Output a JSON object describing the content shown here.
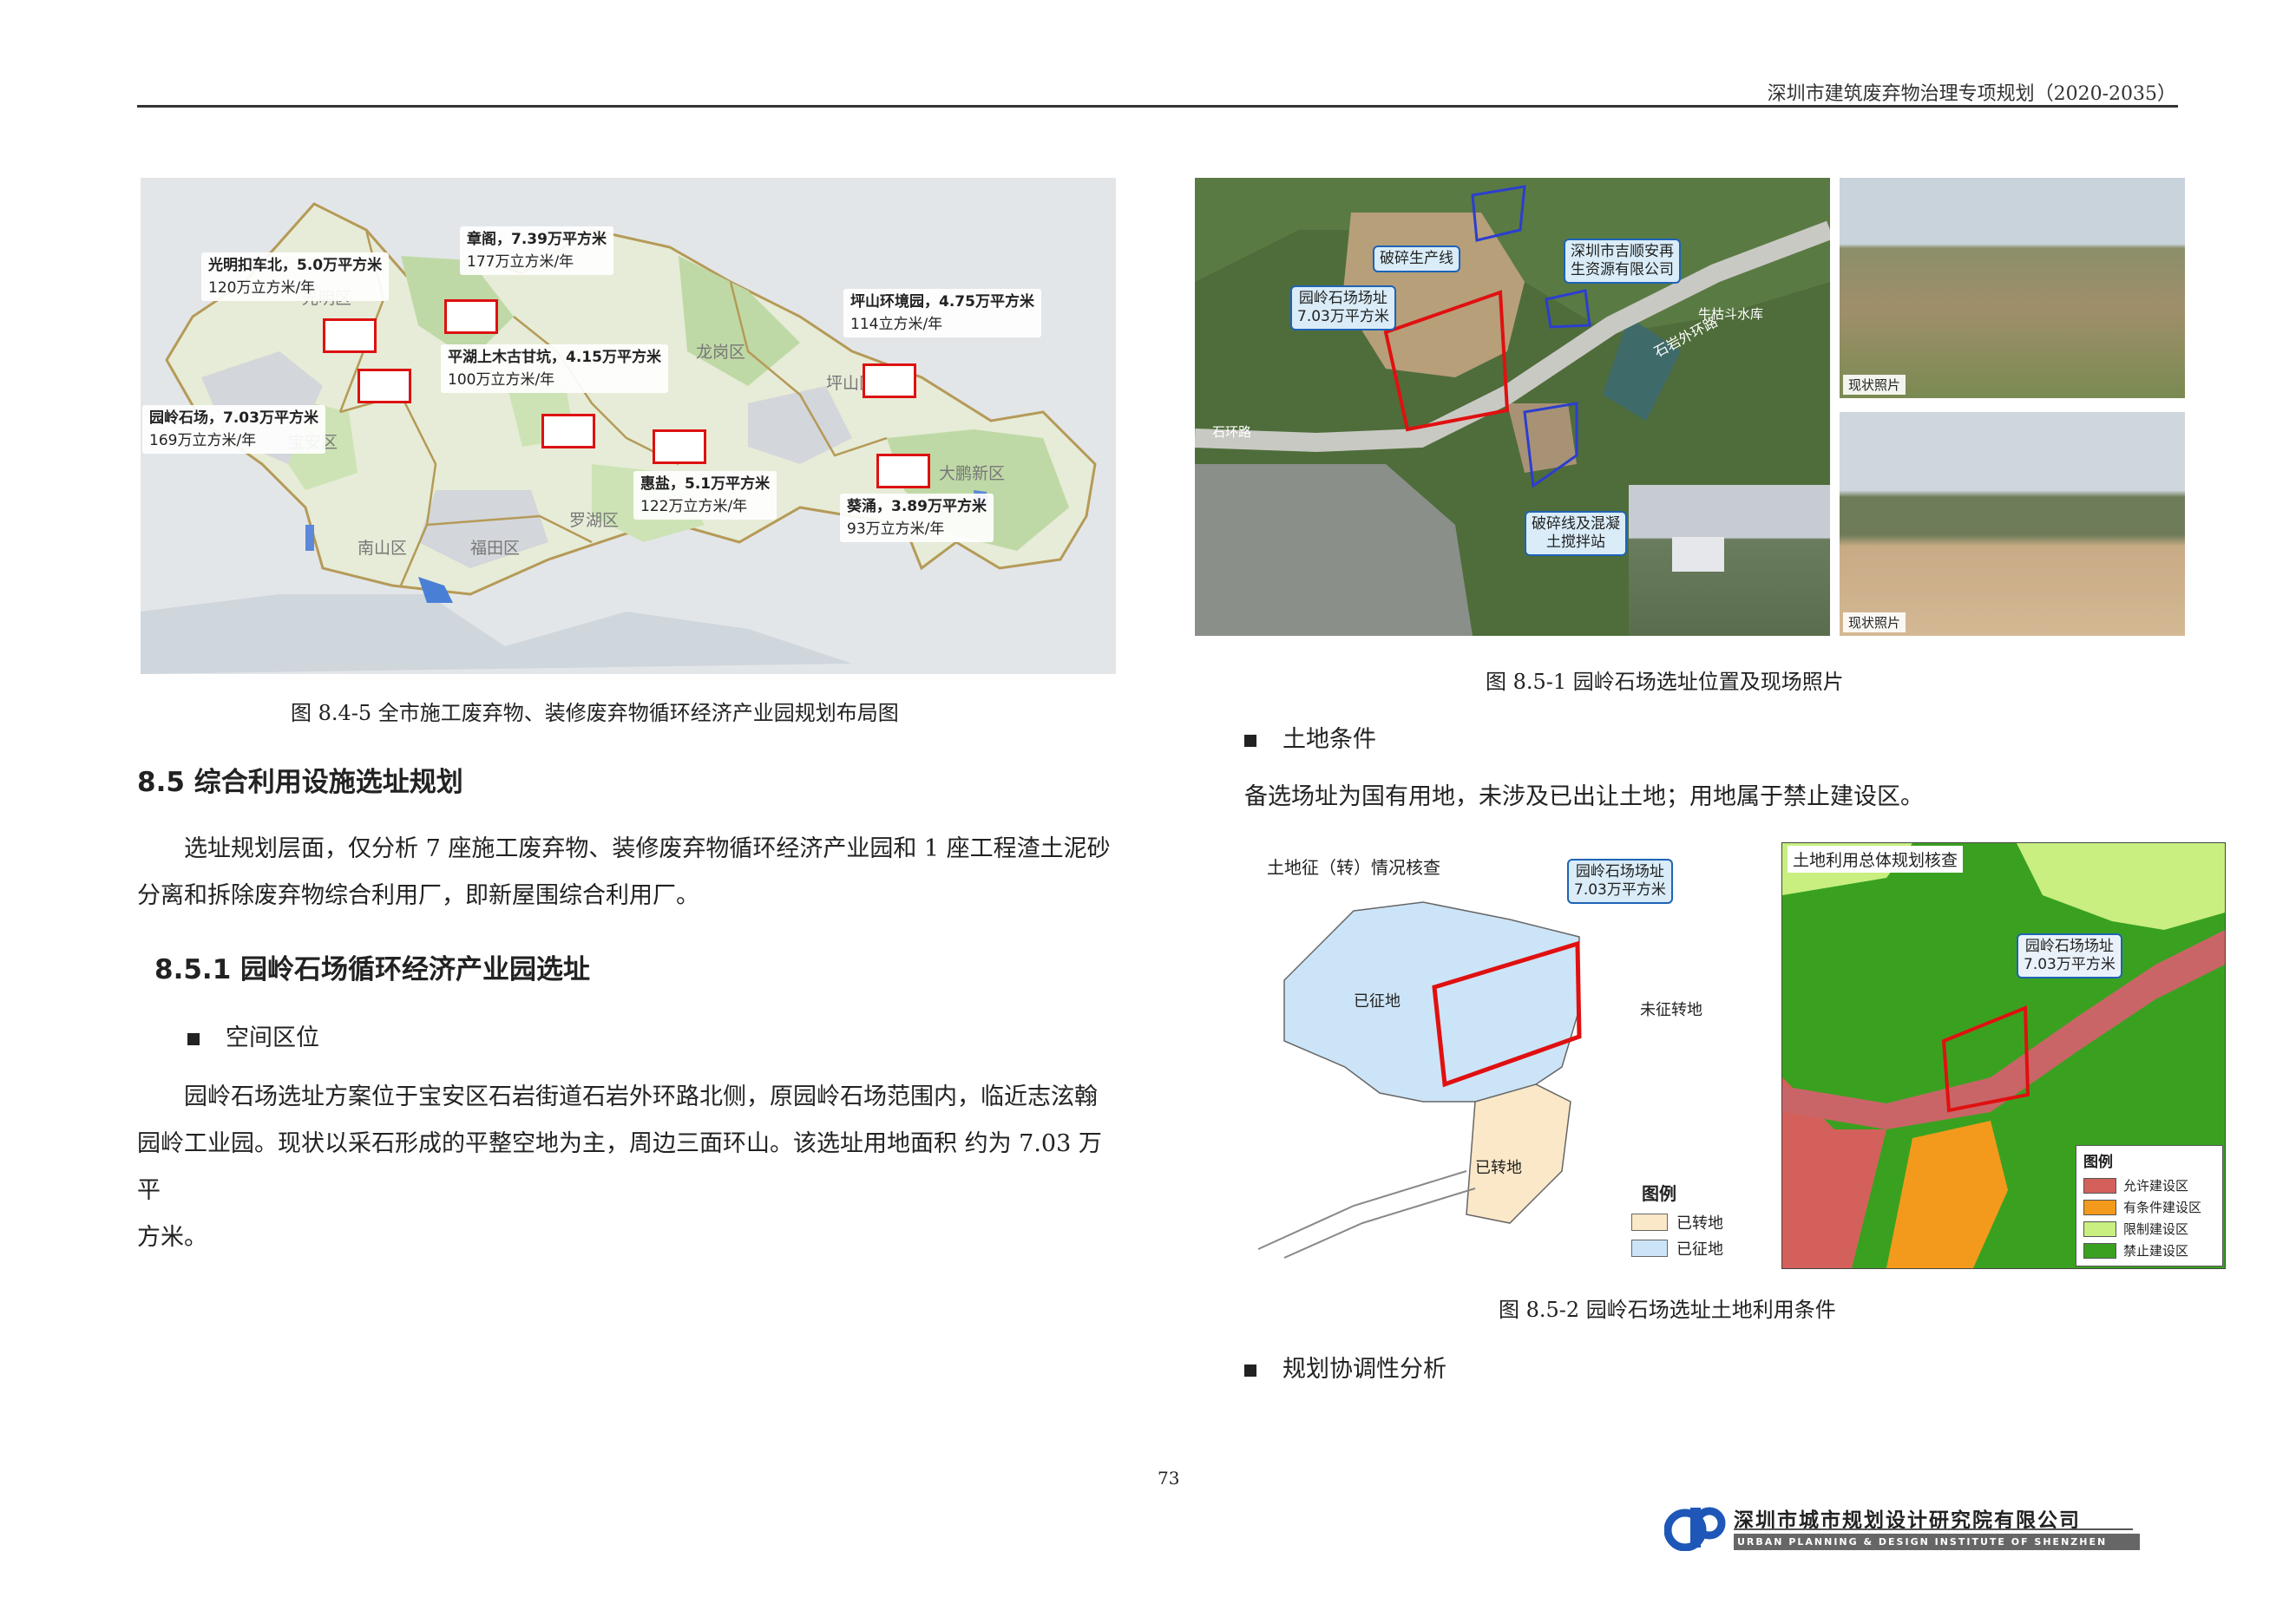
{
  "header": {
    "doc_title": "深圳市建筑废弃物治理专项规划（2020-2035）"
  },
  "left_figure": {
    "caption": "图 8.4-5  全市施工废弃物、装修废弃物循环经济产业园规划布局图",
    "districts": [
      "光明区",
      "龙岗区",
      "坪山区",
      "宝安区",
      "大鹏新区",
      "罗湖区",
      "南山区",
      "福田区"
    ],
    "parks": [
      {
        "name": "光明扣车北，5.0万平方米",
        "capacity": "120万立方米/年"
      },
      {
        "name": "章阁，7.39万平方米",
        "capacity": "177万立方米/年"
      },
      {
        "name": "坪山环境园，4.75万平方米",
        "capacity": "114立方米/年"
      },
      {
        "name": "平湖上木古甘坑，4.15万平方米",
        "capacity": "100万立方米/年"
      },
      {
        "name": "园岭石场，7.03万平方米",
        "capacity": "169万立方米/年"
      },
      {
        "name": "惠盐，5.1万平方米",
        "capacity": "122万立方米/年"
      },
      {
        "name": "葵涌，3.89万平方米",
        "capacity": "93万立方米/年"
      }
    ]
  },
  "section_8_5": {
    "heading": "8.5 综合利用设施选址规划",
    "para1_line1": "选址规划层面，仅分析 7 座施工废弃物、装修废弃物循环经济产业园和 1 座工程渣土泥砂",
    "para1_line2": "分离和拆除废弃物综合利用厂，即新屋围综合利用厂。"
  },
  "section_8_5_1": {
    "heading": "8.5.1 园岭石场循环经济产业园选址",
    "bullet1": "空间区位",
    "para_line1": "园岭石场选址方案位于宝安区石岩街道石岩外环路北侧，原园岭石场范围内，临近志泫翰",
    "para_line2": "园岭工业园。现状以采石形成的平整空地为主，周边三面环山。该选址用地面积 约为 7.03 万平",
    "para_line3": "方米。"
  },
  "right_figure1": {
    "caption": "图 8.5-1  园岭石场选址位置及现场照片",
    "label_crusher": "破碎生产线",
    "label_company": "深圳市吉顺安再\n生资源有限公司",
    "label_site_name": "园岭石场场址",
    "label_site_area": "7.03万平方米",
    "label_concrete": "破碎线及混凝\n土搅拌站",
    "label_reservoir": "牛枯斗水库",
    "label_road": "石环路",
    "label_road2": "石岩外环路",
    "photo_tag": "现状照片"
  },
  "land_conditions": {
    "bullet": "土地条件",
    "text": "备选场址为国有用地，未涉及已出让土地；用地属于禁止建设区。"
  },
  "right_figure2": {
    "caption": "图 8.5-2  园岭石场选址土地利用条件",
    "left_title": "土地征（转）情况核查",
    "site_name": "园岭石场场址",
    "site_area": "7.03万平方米",
    "acquired": "已征地",
    "not_acquired": "未征转地",
    "converted": "已转地",
    "legend_title": "图例",
    "legend": [
      "已转地",
      "已征地"
    ],
    "right_title": "土地利用总体规划核查",
    "legend2_title": "图例",
    "legend2": [
      {
        "label": "允许建设区",
        "color": "#d4605c"
      },
      {
        "label": "有条件建设区",
        "color": "#f39a1c"
      },
      {
        "label": "限制建设区",
        "color": "#c8ef80"
      },
      {
        "label": "禁止建设区",
        "color": "#3aa120"
      }
    ]
  },
  "planning_bullet": "规划协调性分析",
  "page_number": "73",
  "footer": {
    "org_cn": "深圳市城市规划设计研究院有限公司",
    "org_en": "URBAN PLANNING & DESIGN INSTITUTE OF SHENZHEN"
  }
}
